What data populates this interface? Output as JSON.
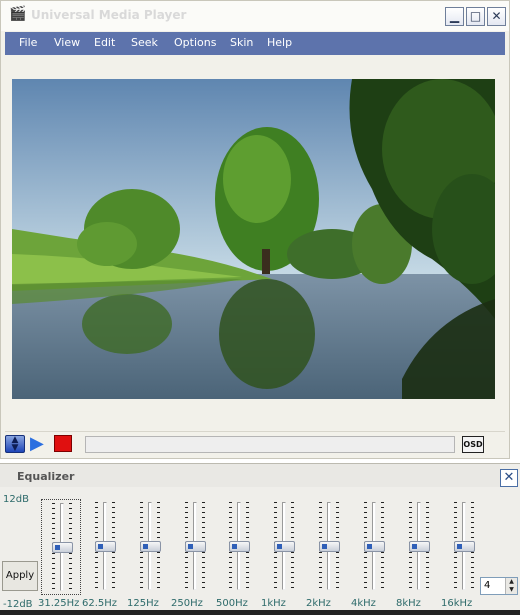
{
  "window": {
    "title": "Universal Media Player"
  },
  "menu": [
    "File",
    "View",
    "Edit",
    "Seek",
    "Options",
    "Skin",
    "Help"
  ],
  "controls": {
    "osd_label": "OSD",
    "seek_progress_percent": 0
  },
  "equalizer": {
    "title": "Equalizer",
    "db_max": "12dB",
    "db_min": "-12dB",
    "apply_label": "Apply",
    "bands": [
      {
        "label": "31.25Hz",
        "value_db": 0
      },
      {
        "label": "62.5Hz",
        "value_db": 0
      },
      {
        "label": "125Hz",
        "value_db": 0
      },
      {
        "label": "250Hz",
        "value_db": 0
      },
      {
        "label": "500Hz",
        "value_db": 0
      },
      {
        "label": "1kHz",
        "value_db": 0
      },
      {
        "label": "2kHz",
        "value_db": 0
      },
      {
        "label": "4kHz",
        "value_db": 0
      },
      {
        "label": "8kHz",
        "value_db": 0
      },
      {
        "label": "16kHz",
        "value_db": 0
      }
    ],
    "spin_value": "4"
  },
  "icons": {
    "app": "media-player-icon",
    "minimize": "minimize-icon",
    "maximize": "maximize-icon",
    "close": "close-icon",
    "play": "play-icon",
    "stop": "stop-icon"
  },
  "colors": {
    "menubar": "#5d73ac",
    "stop": "#e01010",
    "play": "#2b6fe0",
    "eq_labels": "#2d6a6a"
  }
}
